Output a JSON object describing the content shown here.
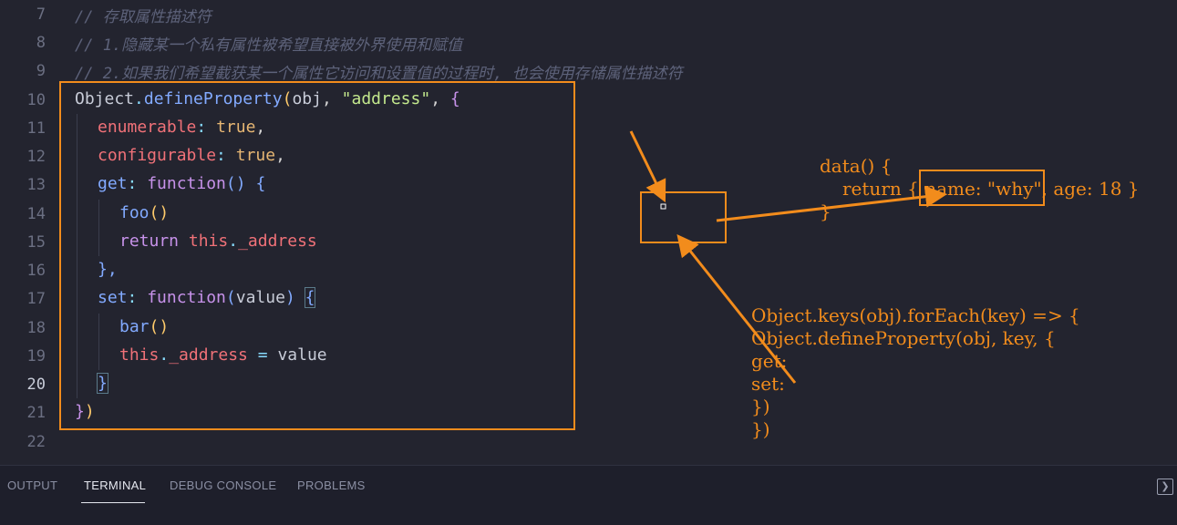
{
  "editor": {
    "lines": [
      {
        "num": "7",
        "text": "// 存取属性描述符"
      },
      {
        "num": "8",
        "text": "// 1.隐藏某一个私有属性被希望直接被外界使用和赋值"
      },
      {
        "num": "9",
        "text": "// 2.如果我们希望截获某一个属性它访问和设置值的过程时, 也会使用存储属性描述符"
      },
      {
        "num": "10"
      },
      {
        "num": "11"
      },
      {
        "num": "12"
      },
      {
        "num": "13"
      },
      {
        "num": "14"
      },
      {
        "num": "15"
      },
      {
        "num": "16"
      },
      {
        "num": "17"
      },
      {
        "num": "18"
      },
      {
        "num": "19"
      },
      {
        "num": "20"
      },
      {
        "num": "21"
      },
      {
        "num": "22"
      }
    ],
    "tokens": {
      "object": "Object",
      "dot": ".",
      "define_property": "defineProperty",
      "paren_open": "(",
      "paren_close": ")",
      "obj": "obj",
      "comma": ",",
      "address_str": "\"address\"",
      "brace_open": "{",
      "brace_close": "}",
      "enumerable": "enumerable",
      "configurable": "configurable",
      "colon": ":",
      "true": "true",
      "get": "get",
      "set": "set",
      "function": "function",
      "parens": "()",
      "value": "value",
      "foo_call": "foo",
      "bar_call": "bar",
      "return": "return",
      "this": "this",
      "address_prop": "_address",
      "assign": "=",
      "close_brace_comma": "},",
      "close_all": "})"
    }
  },
  "annotations": {
    "data_block": {
      "line1": "data() {",
      "line2": "return {",
      "highlight": "name: \"why\"",
      "line2_tail": ", age: 18 }",
      "line3": "}"
    },
    "keys_block": [
      "Object.keys(obj).forEach(key) => {",
      "Object.defineProperty(obj, key, {",
      "get:",
      "set:",
      "})",
      "})"
    ],
    "color": "#f28c1c"
  },
  "panel": {
    "tabs": [
      "OUTPUT",
      "TERMINAL",
      "DEBUG CONSOLE",
      "PROBLEMS"
    ],
    "active_tab": "TERMINAL",
    "maximize_icon": "chevron-right-box-icon"
  }
}
